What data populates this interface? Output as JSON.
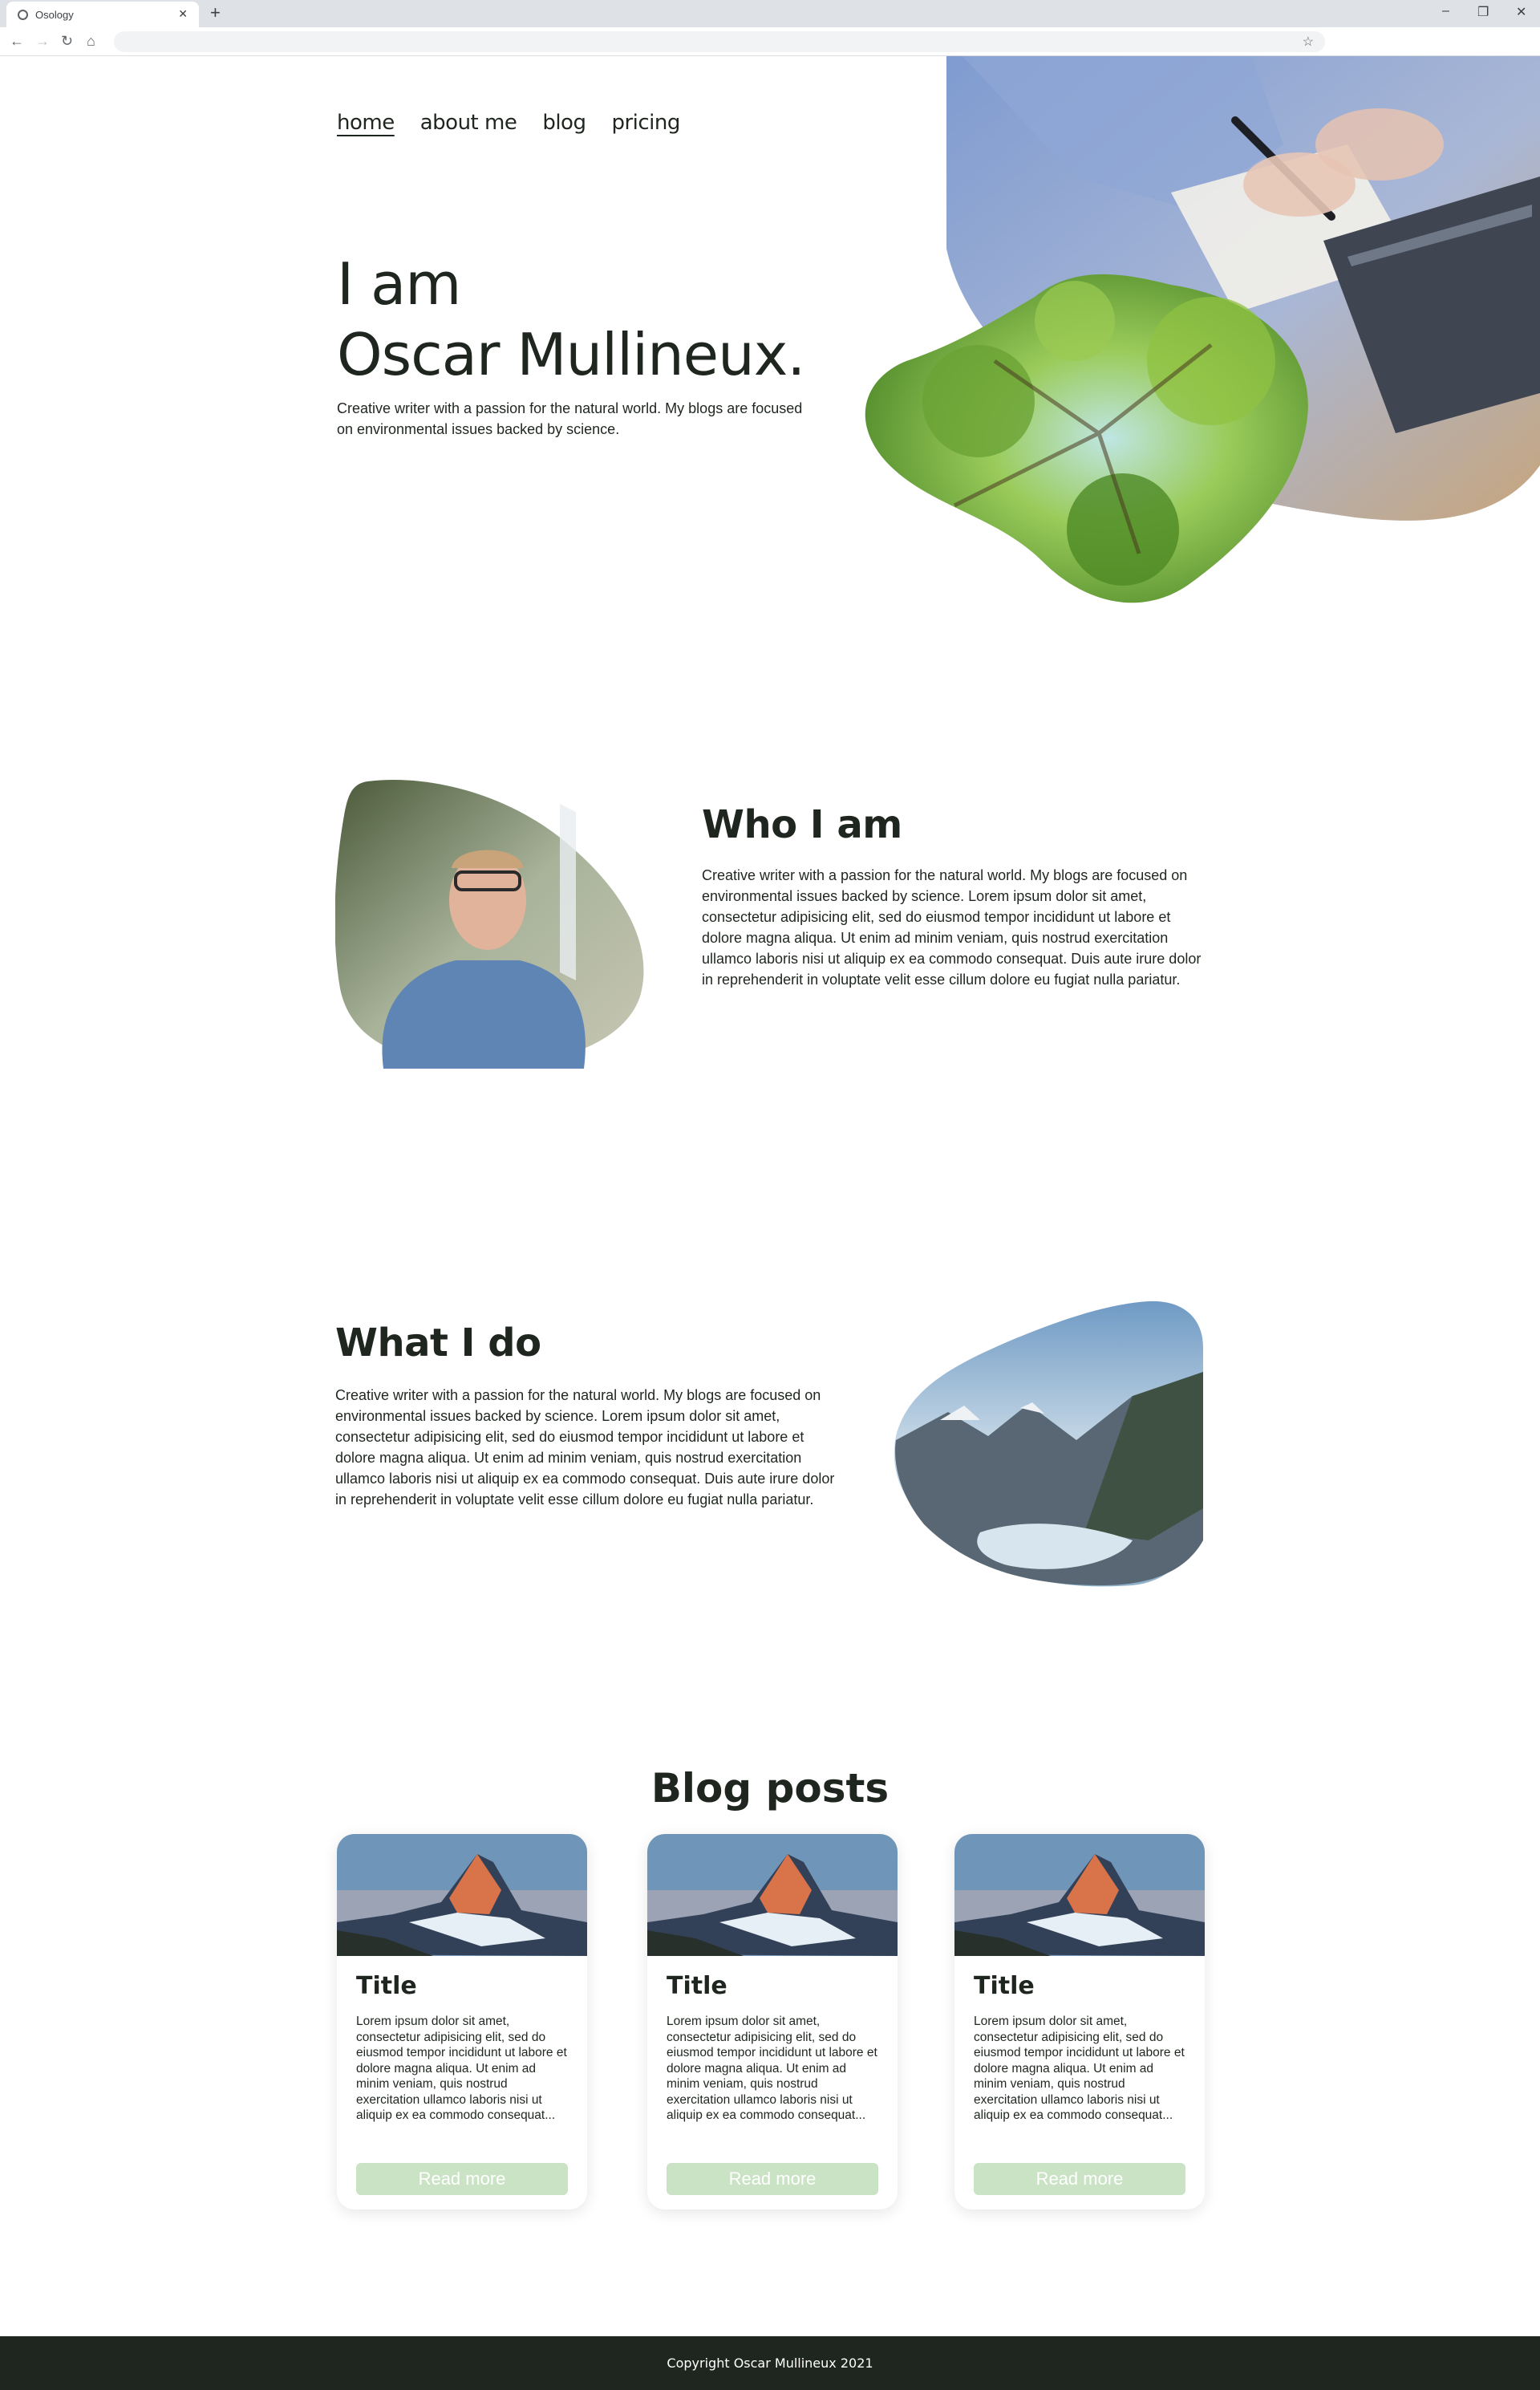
{
  "browser": {
    "tab_title": "Osology",
    "tab_close": "✕",
    "new_tab": "+",
    "minimize": "–",
    "restore": "❐",
    "close": "✕",
    "back": "←",
    "forward": "→",
    "reload": "↻",
    "home": "⌂",
    "bookmark_star": "☆"
  },
  "nav": {
    "items": [
      {
        "label": "home",
        "active": true
      },
      {
        "label": "about me"
      },
      {
        "label": "blog"
      },
      {
        "label": "pricing"
      }
    ]
  },
  "hero": {
    "title_line1": "I am",
    "title_line2": "Oscar Mullineux.",
    "subtitle": "Creative writer with a passion for the natural world. My blogs are focused on environmental issues backed by science."
  },
  "who": {
    "title": "Who I am",
    "text": "Creative writer with a passion for the natural world. My blogs are focused on environmental issues backed by science. Lorem ipsum dolor sit amet, consectetur adipisicing elit, sed do eiusmod tempor incididunt ut labore et dolore magna aliqua. Ut enim ad minim veniam, quis nostrud exercitation ullamco laboris nisi ut aliquip ex ea commodo consequat. Duis aute irure dolor in reprehenderit in voluptate velit esse cillum dolore eu fugiat nulla pariatur."
  },
  "what": {
    "title": "What I do",
    "text": "Creative writer with a passion for the natural world. My blogs are focused on environmental issues backed by science. Lorem ipsum dolor sit amet, consectetur adipisicing elit, sed do eiusmod tempor incididunt ut labore et dolore magna aliqua. Ut enim ad minim veniam, quis nostrud exercitation ullamco laboris nisi ut aliquip ex ea commodo consequat. Duis aute irure dolor in reprehenderit in voluptate velit esse cillum dolore eu fugiat nulla pariatur."
  },
  "blog": {
    "heading": "Blog posts",
    "cards": [
      {
        "title": "Title",
        "text": "Lorem ipsum dolor sit amet, consectetur adipisicing elit, sed do eiusmod tempor incididunt ut labore et dolore magna aliqua. Ut enim ad minim veniam, quis nostrud exercitation ullamco laboris nisi ut aliquip ex ea commodo consequat...",
        "button": "Read more"
      },
      {
        "title": "Title",
        "text": "Lorem ipsum dolor sit amet, consectetur adipisicing elit, sed do eiusmod tempor incididunt ut labore et dolore magna aliqua. Ut enim ad minim veniam, quis nostrud exercitation ullamco laboris nisi ut aliquip ex ea commodo consequat...",
        "button": "Read more"
      },
      {
        "title": "Title",
        "text": "Lorem ipsum dolor sit amet, consectetur adipisicing elit, sed do eiusmod tempor incididunt ut labore et dolore magna aliqua. Ut enim ad minim veniam, quis nostrud exercitation ullamco laboris nisi ut aliquip ex ea commodo consequat...",
        "button": "Read more"
      }
    ]
  },
  "footer": {
    "copyright": "Copyright Oscar Mullineux 2021"
  },
  "colors": {
    "text": "#1f261f",
    "button": "#c9e3c4",
    "footer_bg": "#1f261f"
  }
}
